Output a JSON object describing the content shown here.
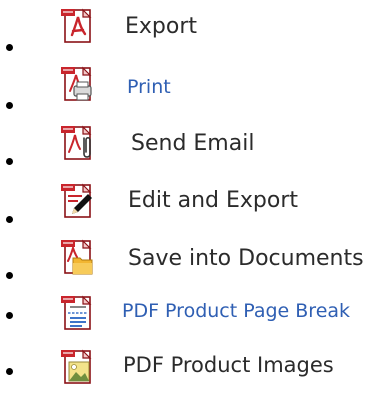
{
  "colors": {
    "text": "#2b2b2b",
    "link": "#2f5fb3",
    "pdf_red": "#c9252c",
    "pdf_dark_red": "#8b1217"
  },
  "menu": {
    "items": [
      {
        "label": "Export",
        "icon": "pdf-export-icon",
        "style": "plain"
      },
      {
        "label": "Print",
        "icon": "pdf-print-icon",
        "style": "link"
      },
      {
        "label": "Send Email",
        "icon": "pdf-email-icon",
        "style": "plain"
      },
      {
        "label": "Edit and Export",
        "icon": "pdf-edit-icon",
        "style": "plain"
      },
      {
        "label": "Save into Documents",
        "icon": "pdf-folder-icon",
        "style": "plain"
      },
      {
        "label": "PDF Product Page Break",
        "icon": "pdf-page-break-icon",
        "style": "link"
      },
      {
        "label": "PDF Product Images",
        "icon": "pdf-image-icon",
        "style": "plain"
      }
    ]
  }
}
